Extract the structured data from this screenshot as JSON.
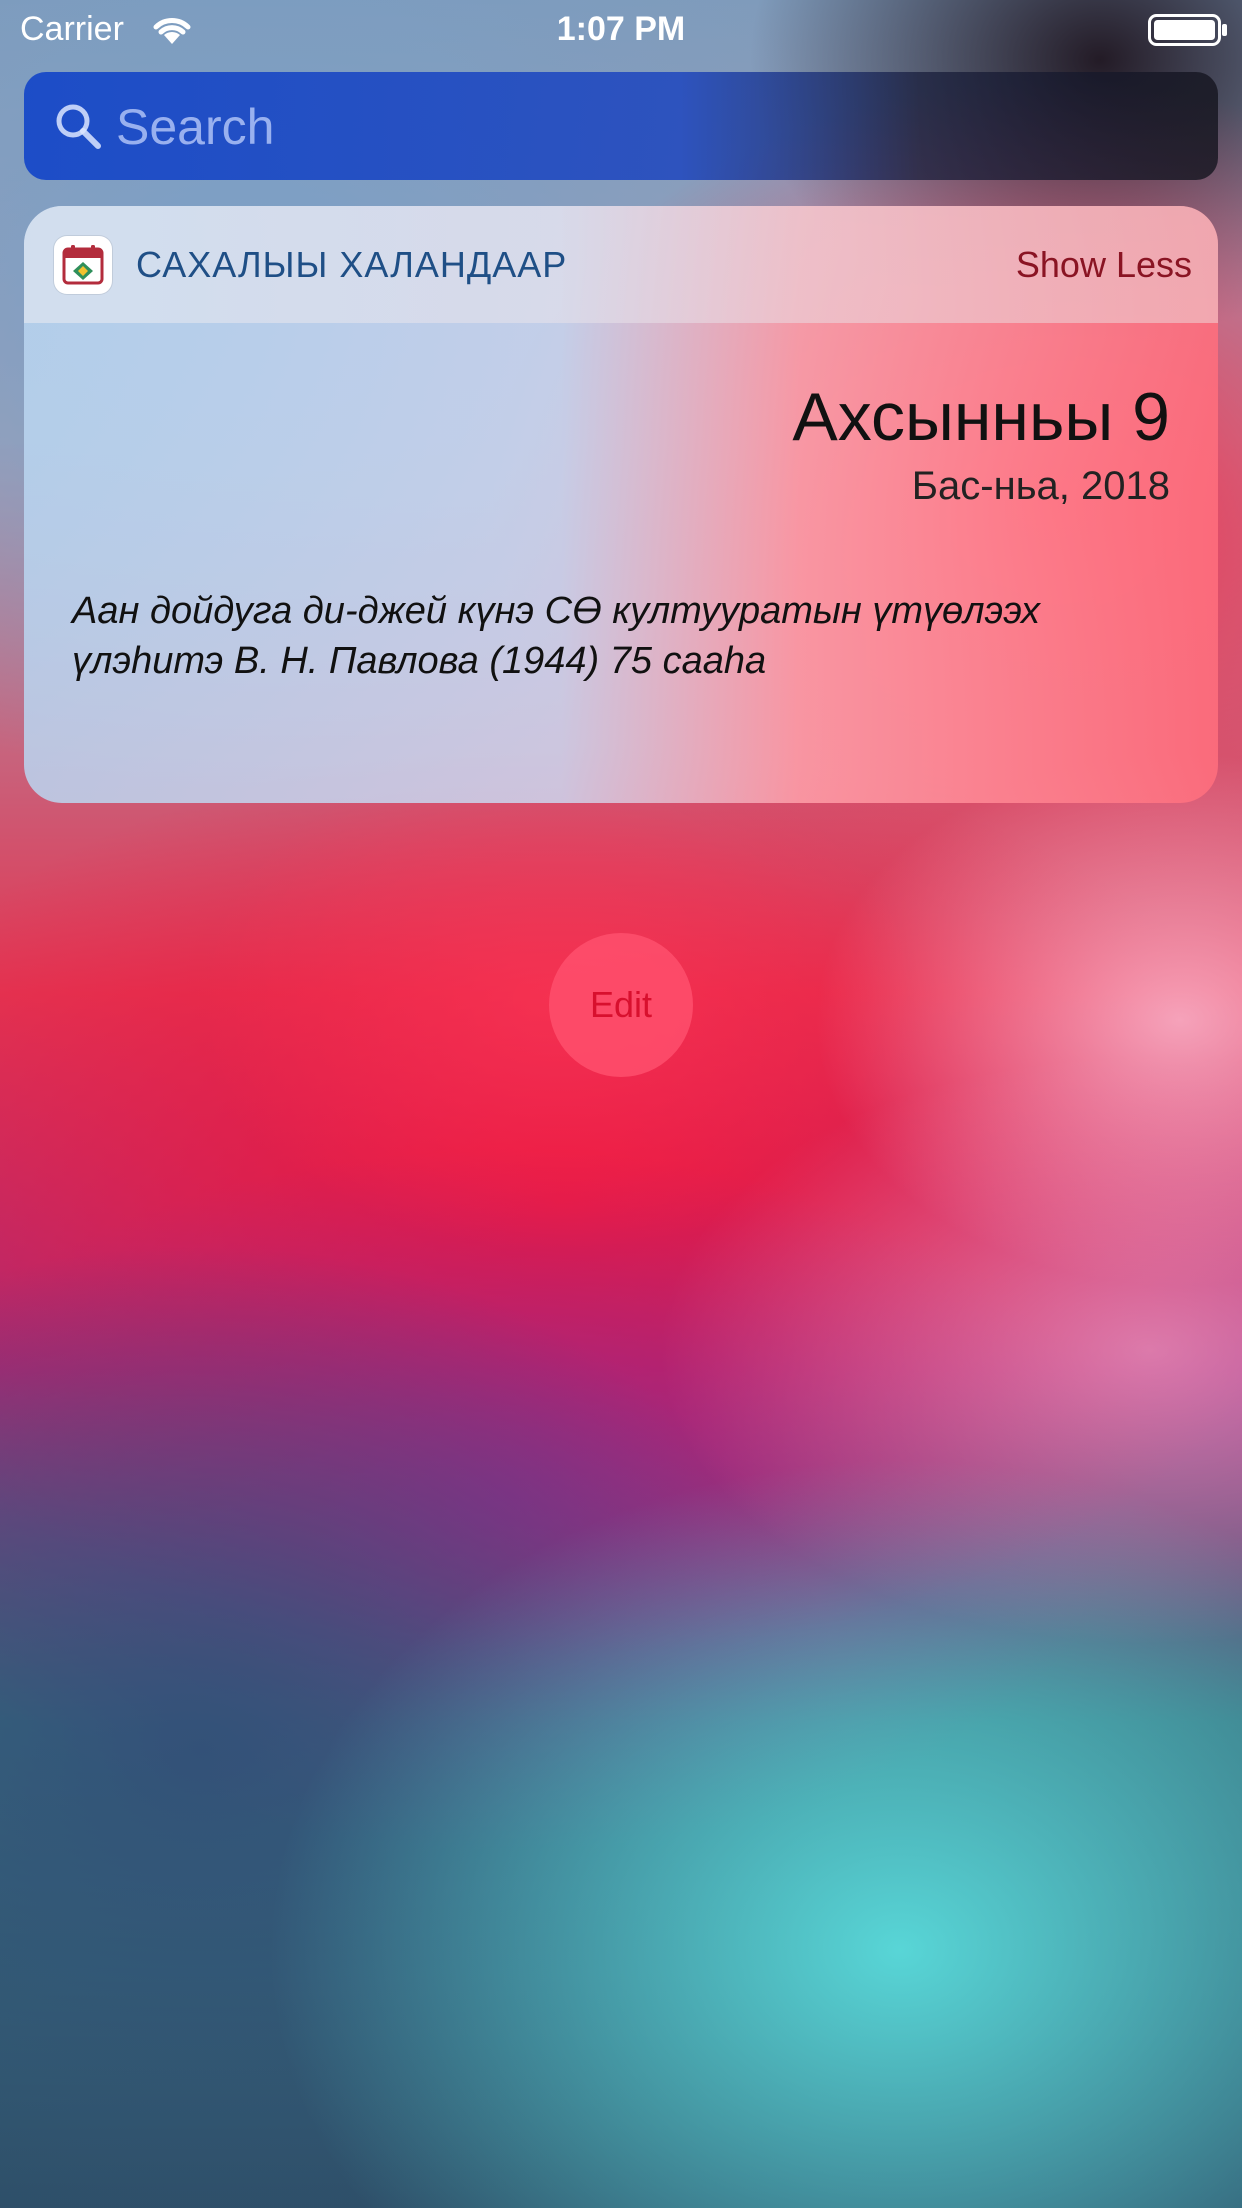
{
  "status_bar": {
    "carrier": "Carrier",
    "time": "1:07 PM"
  },
  "search": {
    "placeholder": "Search",
    "value": ""
  },
  "widget": {
    "app_name": "САХАЛЫЫ ХАЛАНДААР",
    "show_less_label": "Show Less",
    "day": "Ахсынньы 9",
    "month_year": "Бас-ньа, 2018",
    "event": "Аан дойдуга ди-джей күнэ СӨ култууратын үтүөлээх үлэһитэ В. Н. Павлова (1944) 75 сааһа"
  },
  "edit_label": "Edit",
  "icons": {
    "wifi": "wifi-icon",
    "battery": "battery-icon",
    "search": "search-icon",
    "app": "calendar-icon"
  },
  "colors": {
    "app_name": "#1f4f86",
    "show_less": "#8a1423",
    "edit_text": "#d8102e"
  }
}
